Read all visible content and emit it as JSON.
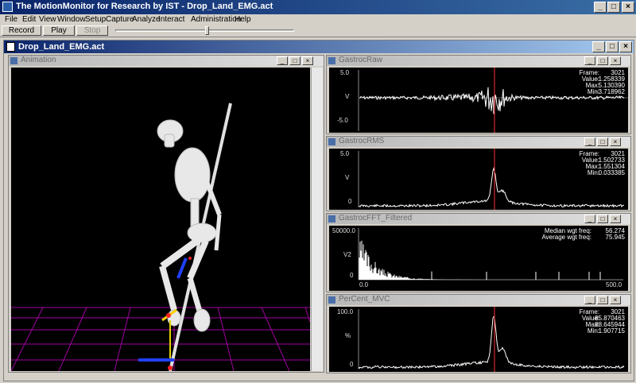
{
  "app": {
    "title": "The MotionMonitor for Research by IST - Drop_Land_EMG.act",
    "caption_buttons": [
      "_",
      "□",
      "×"
    ]
  },
  "menu": [
    "File",
    "Edit",
    "View",
    "Window",
    "Setup",
    "Capture",
    "Analyze",
    "Interact",
    "Administration",
    "Help"
  ],
  "toolbar": {
    "record": "Record",
    "play": "Play",
    "stop": "Stop"
  },
  "document": {
    "title": "Drop_Land_EMG.act"
  },
  "panels": {
    "animation": {
      "title": "Animation"
    },
    "gastroc_raw": {
      "title": "GastrocRaw",
      "ymax": "5.0",
      "ymid": "V",
      "ymin": "-5.0",
      "readout_labels": [
        "Frame:",
        "Value:",
        "Max:",
        "Min:"
      ],
      "readout_values": [
        "3021",
        "-1.258339",
        "5.130390",
        "-3.718962"
      ]
    },
    "gastroc_rms": {
      "title": "GastrocRMS",
      "ymax": "5.0",
      "ymid": "V",
      "ymin": "0",
      "readout_labels": [
        "Frame:",
        "Value:",
        "Max:",
        "Min:"
      ],
      "readout_values": [
        "3021",
        "1.502733",
        "1.551304",
        "0.033385"
      ]
    },
    "gastroc_fft": {
      "title": "GastrocFFT_Filtered",
      "ymax": "50000.0",
      "ymid": "V2",
      "ymin": "0",
      "xmin": "0.0",
      "xmax": "500.0",
      "readout_labels": [
        "Median wgt freq:",
        "Average wgt freq:"
      ],
      "readout_values": [
        "56.274",
        "75.945"
      ]
    },
    "percent_mvc": {
      "title": "PerCent_MVC",
      "ymax": "100.0",
      "ymid": "%",
      "ymin": "0",
      "readout_labels": [
        "Frame:",
        "Value:",
        "Max:",
        "Min:"
      ],
      "readout_values": [
        "3021",
        "85.870463",
        "88.645944",
        "1.907715"
      ]
    }
  },
  "colors": {
    "cursor": "#ff3030",
    "trace": "#ffffff",
    "grid": "#a000a0",
    "titlebar": "#0a246a"
  },
  "icons": [
    "app-icon",
    "document-icon",
    "minimize-icon",
    "restore-icon",
    "close-icon"
  ]
}
